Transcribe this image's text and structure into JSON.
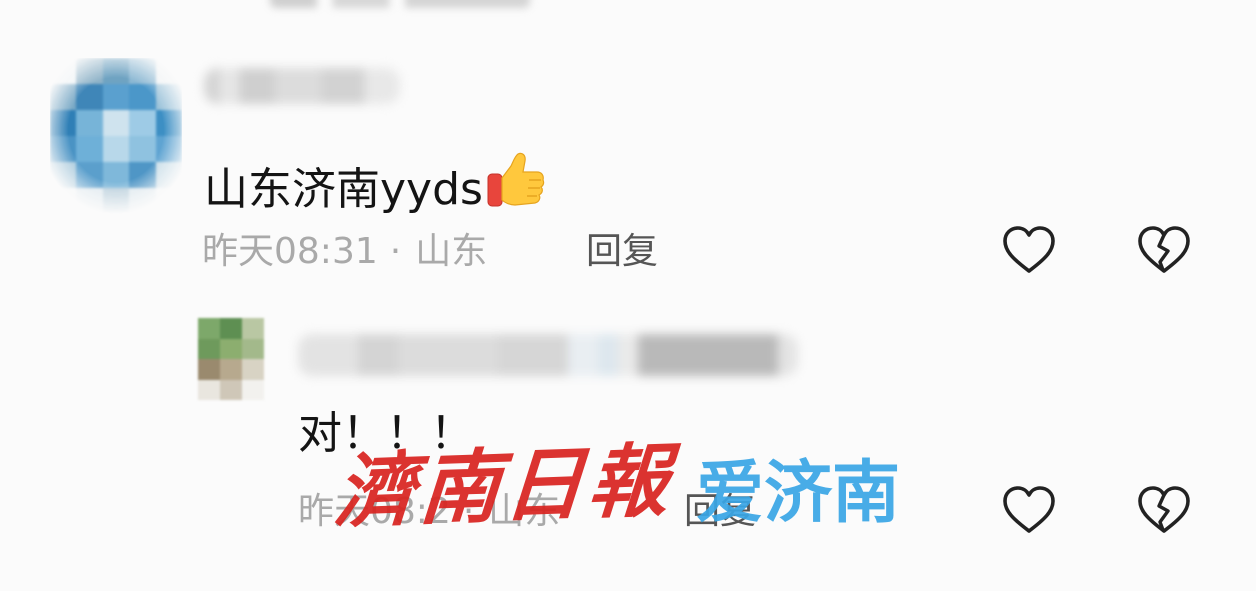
{
  "comments": [
    {
      "text": "山东济南yyds",
      "emoji": "thumbs-up-icon",
      "time": "昨天08:31",
      "separator": "·",
      "location": "山东",
      "reply_label": "回复"
    }
  ],
  "replies": [
    {
      "text": "对！！！",
      "time": "昨天08:2",
      "separator": "·",
      "location": "山东",
      "reply_label": "回复"
    }
  ],
  "watermark": {
    "primary": "濟南日報",
    "secondary": "爱济南"
  },
  "colors": {
    "background": "#fbfbfb",
    "text": "#141414",
    "meta": "#a9a9a9",
    "watermark_red": "#d9231f",
    "watermark_blue": "#39a6e6"
  }
}
